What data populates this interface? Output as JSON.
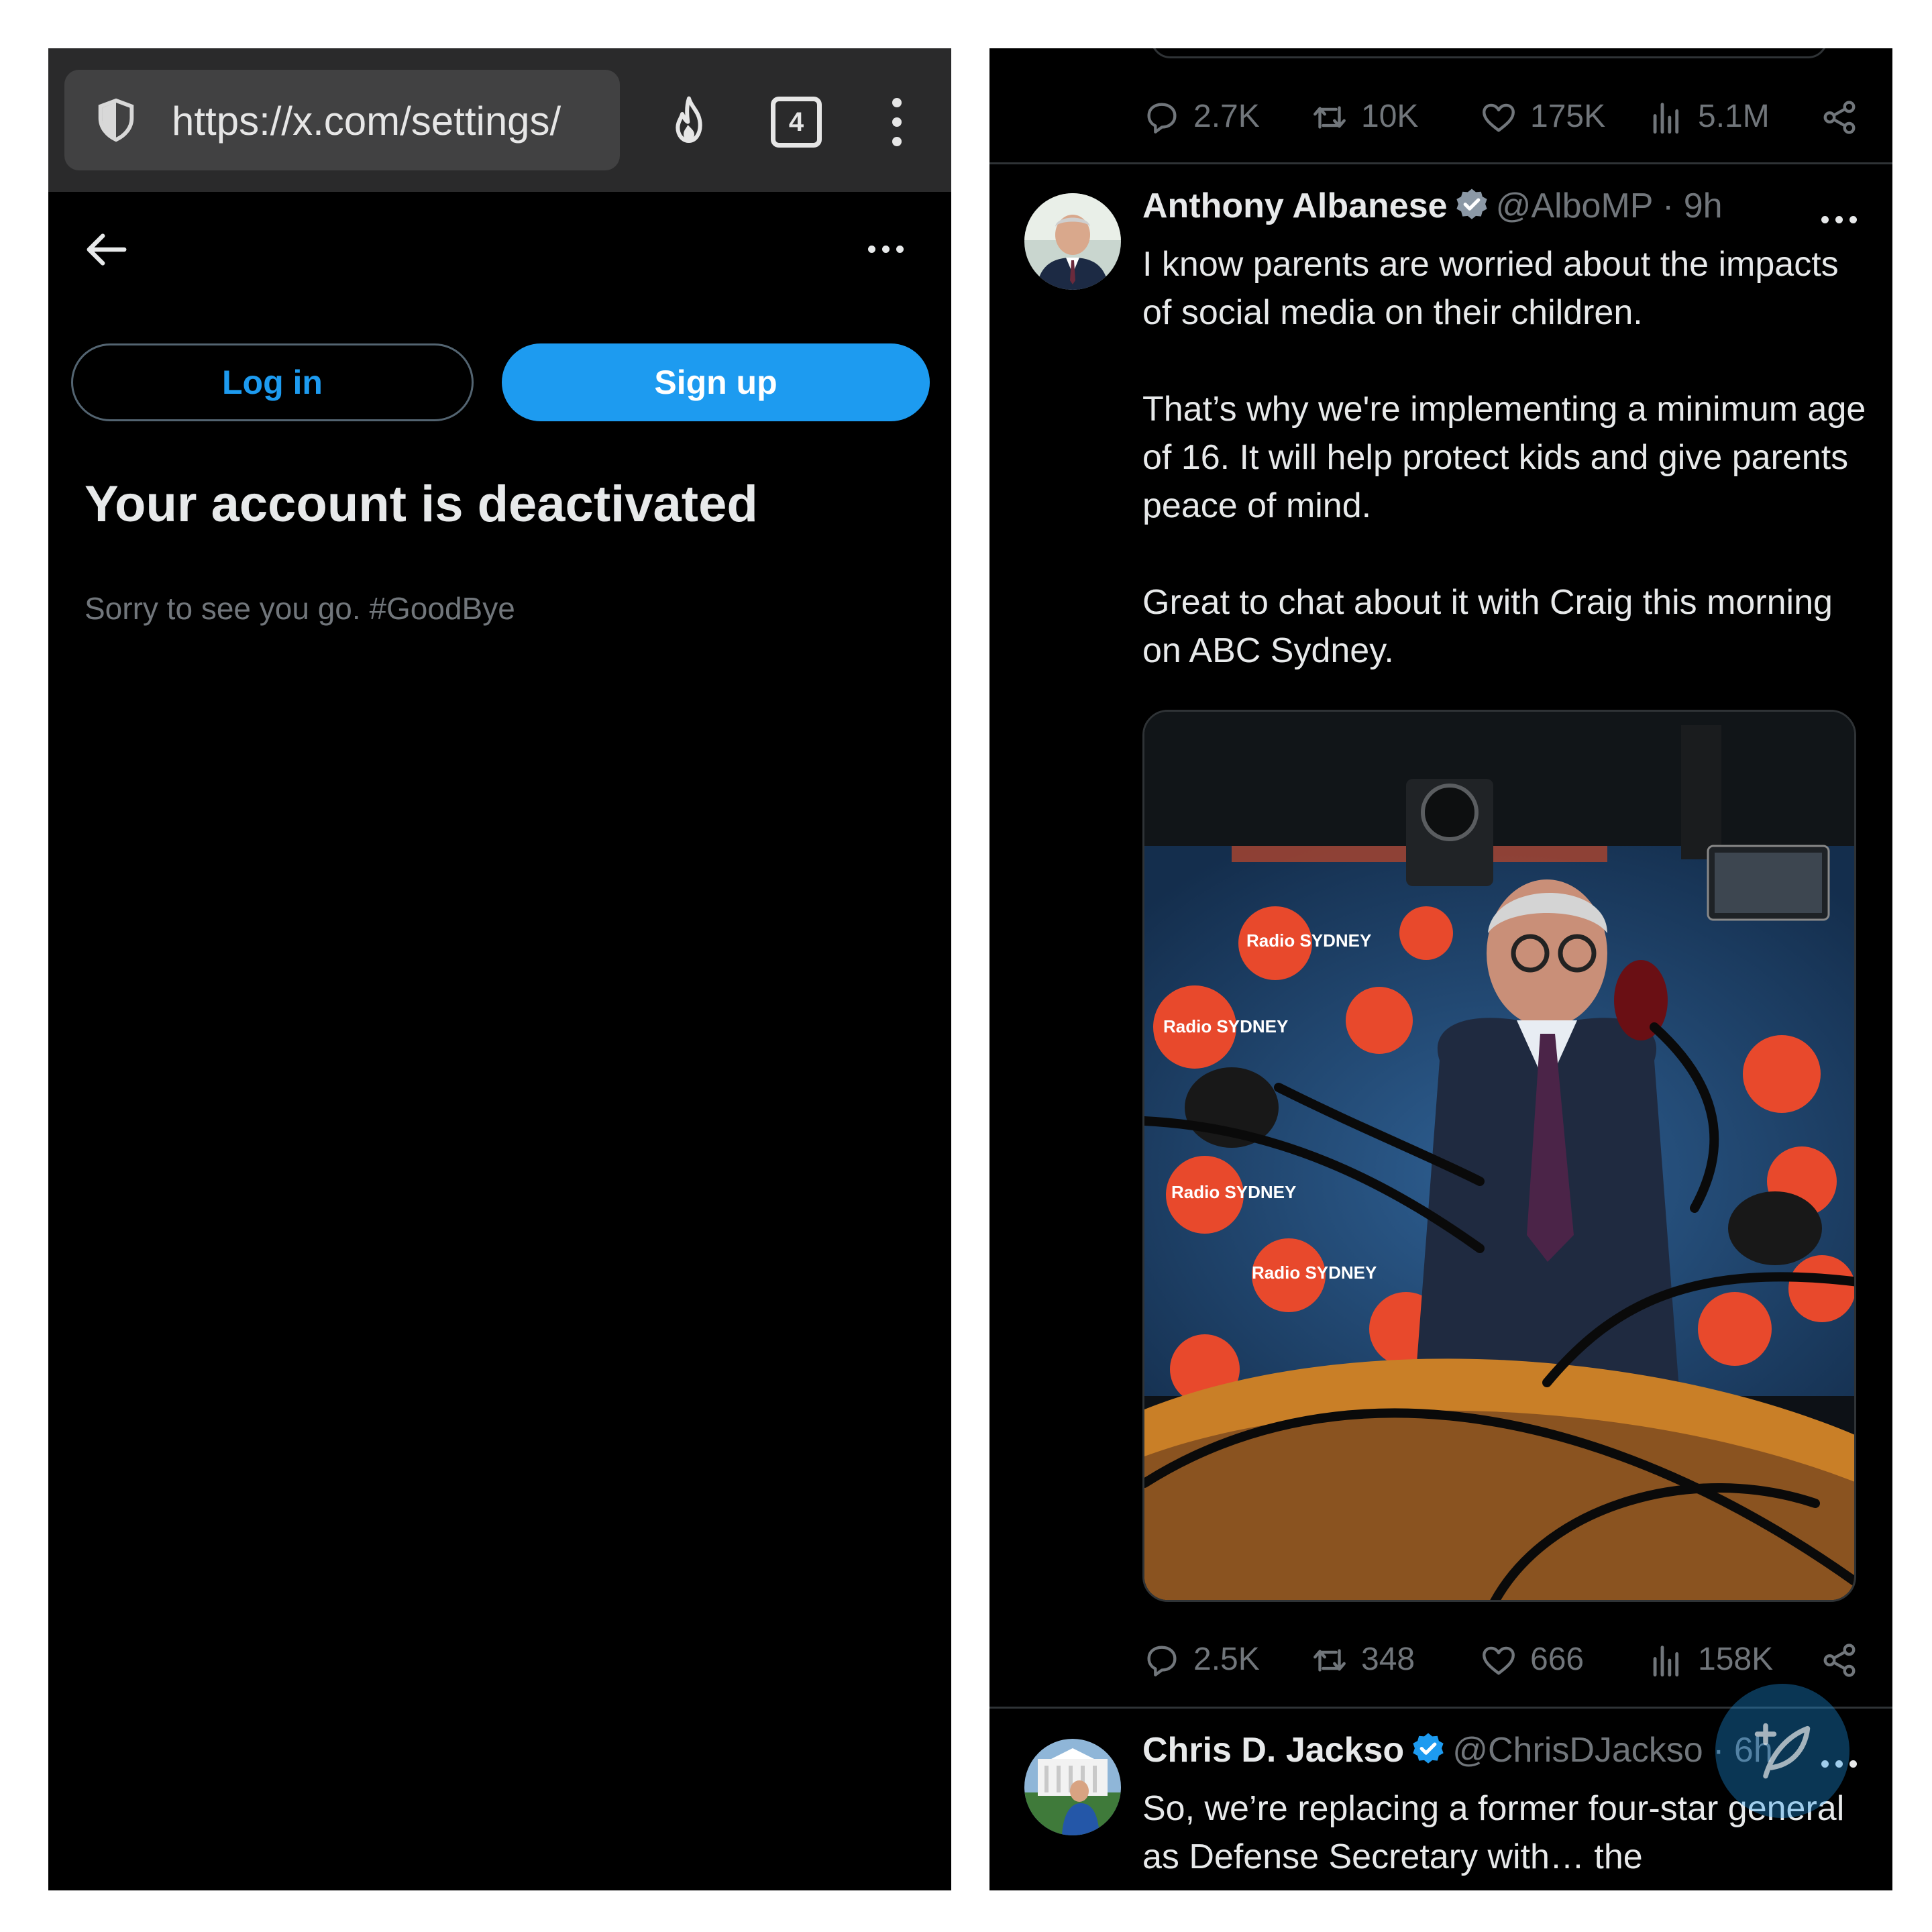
{
  "browser": {
    "url": "https://x.com/settings/",
    "tab_count": "4",
    "icons": [
      "shield-icon",
      "flame-icon",
      "tabs-icon",
      "kebab-menu-icon"
    ]
  },
  "left_page": {
    "login_label": "Log in",
    "signup_label": "Sign up",
    "title": "Your account is deactivated",
    "subtitle": "Sorry to see you go. #GoodBye"
  },
  "tweets": {
    "previous": {
      "replies": "2.7K",
      "reposts": "10K",
      "likes": "175K",
      "views": "5.1M"
    },
    "main": {
      "name": "Anthony Albanese",
      "handle": "@AlboMP · 9h",
      "text": "I know parents are worried about the impacts of social media on their children.\n\nThat’s why we're implementing a minimum age of 16. It will help protect kids and give parents peace of mind.\n\nGreat to chat about it with Craig this morning on ABC Sydney.",
      "image_signs": [
        "Radio SYDNEY",
        "Radio SYDNEY",
        "Radio SYDNEY",
        "Radio SYDNEY"
      ],
      "replies": "2.5K",
      "reposts": "348",
      "likes": "666",
      "views": "158K"
    },
    "next": {
      "name": "Chris D. Jackso",
      "handle": "@ChrisDJackso · 6h",
      "text": "So, we’re replacing a former four-star general as Defense Secretary with… the"
    }
  },
  "colors": {
    "background": "#000000",
    "accent": "#1d9bf0",
    "text_primary": "#e7e9ea",
    "text_secondary": "#71767b",
    "divider": "#2f3336",
    "browser_bar": "#2a2a2b"
  }
}
